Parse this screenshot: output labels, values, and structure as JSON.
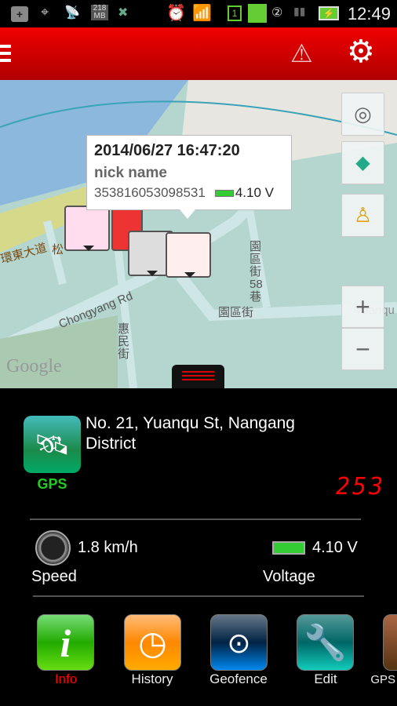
{
  "status_bar": {
    "memory": "218",
    "memory_unit": "MB",
    "sim": "1",
    "time": "12:49"
  },
  "header": {
    "icons": [
      "menu-icon",
      "warning-icon",
      "settings-icon"
    ]
  },
  "map": {
    "labels": {
      "road1": "環東大道",
      "road2": "松",
      "chongyang": "Chongyang Rd",
      "huimin": "惠民街",
      "yuanqu58": "園區街58巷",
      "yuanqu": "園區街",
      "yuanqu_en": "Yuanqu",
      "google": "Google"
    },
    "info_window": {
      "datetime": "2014/06/27 16:47:20",
      "nickname": "nick name",
      "device_id": "353816053098531",
      "voltage": "4.10 V"
    },
    "controls": {
      "zoom_in": "+",
      "zoom_out": "−"
    }
  },
  "panel": {
    "gps_label": "GPS",
    "address": "No. 21, Yuanqu St, Nangang District",
    "heading_display": "253",
    "speed_value": "1.8 km/h",
    "speed_label": "Speed",
    "voltage_value": "4.10 V",
    "voltage_label": "Voltage",
    "accent": "#ff0000"
  },
  "toolbar": [
    {
      "label": "Info",
      "icon": "info-icon",
      "active": true
    },
    {
      "label": "History",
      "icon": "history-icon"
    },
    {
      "label": "Geofence",
      "icon": "geofence-icon"
    },
    {
      "label": "Edit",
      "icon": "wrench-icon"
    },
    {
      "label": "GPS",
      "icon": "gps-icon"
    }
  ]
}
